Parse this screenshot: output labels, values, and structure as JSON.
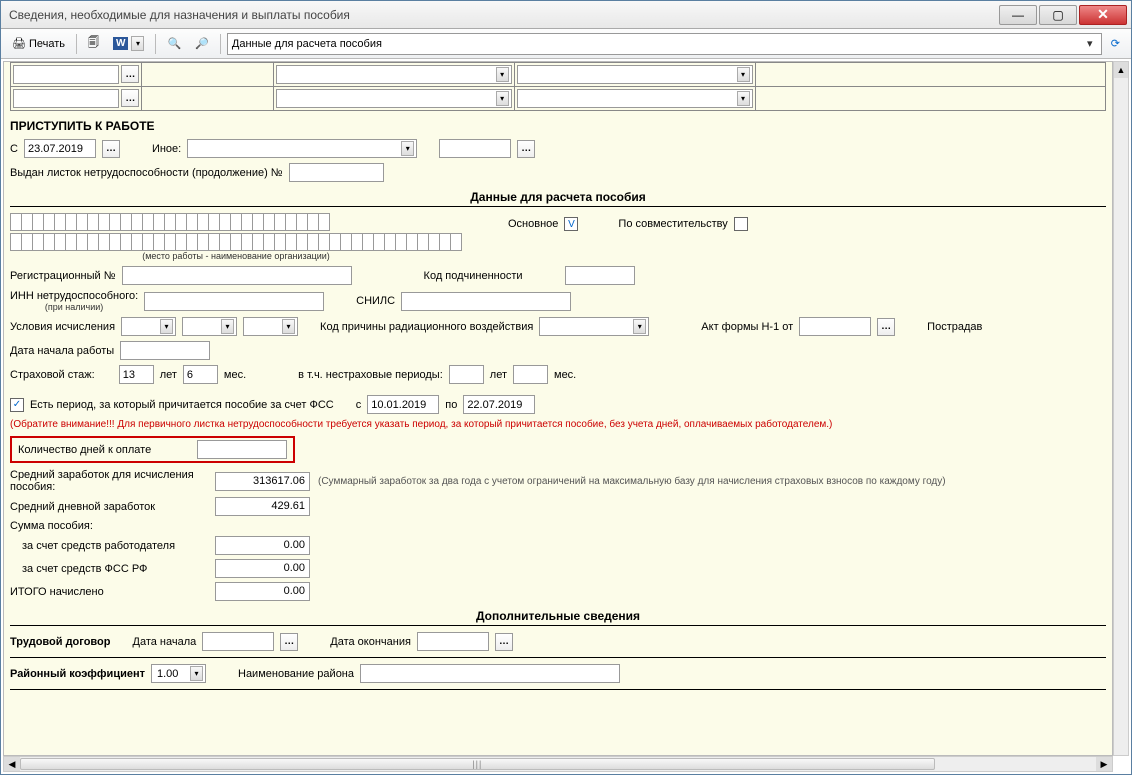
{
  "window": {
    "title": "Сведения, необходимые для назначения и выплаты пособия"
  },
  "toolbar": {
    "print": "Печать",
    "combo_value": "Данные для расчета пособия"
  },
  "start_work": {
    "heading": "ПРИСТУПИТЬ К РАБОТЕ",
    "from_lbl": "С",
    "from_date": "23.07.2019",
    "other_lbl": "Иное:",
    "sheet_lbl": "Выдан листок нетрудоспособности (продолжение) №"
  },
  "calc": {
    "header": "Данные для расчета пособия",
    "workplace_note": "(место работы - наименование организации)",
    "main_lbl": "Основное",
    "main_chk": "V",
    "combi_lbl": "По совместительству",
    "reg_no_lbl": "Регистрационный №",
    "sub_code_lbl": "Код подчиненности",
    "inn_lbl": "ИНН нетрудоспособного:",
    "inn_note": "(при наличии)",
    "snils_lbl": "СНИЛС",
    "cond_lbl": "Условия исчисления",
    "rad_lbl": "Код причины радиационного воздействия",
    "act_lbl": "Акт формы Н-1 от",
    "pstr_lbl": "Пострадав",
    "startdate_lbl": "Дата начала работы",
    "stage_lbl": "Страховой стаж:",
    "stage_years": "13",
    "years_lbl": "лет",
    "stage_months": "6",
    "months_lbl": "мес.",
    "nonins_lbl": "в т.ч. нестраховые периоды:"
  },
  "fss": {
    "chk_lbl": "Есть период, за который причитается пособие за счет ФСС",
    "from_lbl": "с",
    "from_date": "10.01.2019",
    "to_lbl": "по",
    "to_date": "22.07.2019",
    "warning": "(Обратите внимание!!! Для первичного листка нетрудоспособности требуется указать период, за который причитается пособие, без учета дней, оплачиваемых работодателем.)",
    "days_lbl": "Количество дней к оплате"
  },
  "sums": {
    "avg_earn_lbl": "Средний заработок для исчисления пособия:",
    "avg_earn": "313617.06",
    "avg_note": "(Суммарный заработок за два года с учетом ограничений на максимальную базу для начисления страховых взносов по каждому году)",
    "avg_daily_lbl": "Средний дневной заработок",
    "avg_daily": "429.61",
    "sum_lbl": "Сумма пособия:",
    "employer_lbl": "за счет средств работодателя",
    "employer": "0.00",
    "fssrf_lbl": "за счет средств ФСС РФ",
    "fssrf": "0.00",
    "total_lbl": "ИТОГО начислено",
    "total": "0.00"
  },
  "extra": {
    "header": "Дополнительные сведения",
    "contract_lbl": "Трудовой договор",
    "start_lbl": "Дата начала",
    "end_lbl": "Дата окончания",
    "coef_lbl": "Районный коэффициент",
    "coef_val": "1.00",
    "region_lbl": "Наименование района"
  }
}
